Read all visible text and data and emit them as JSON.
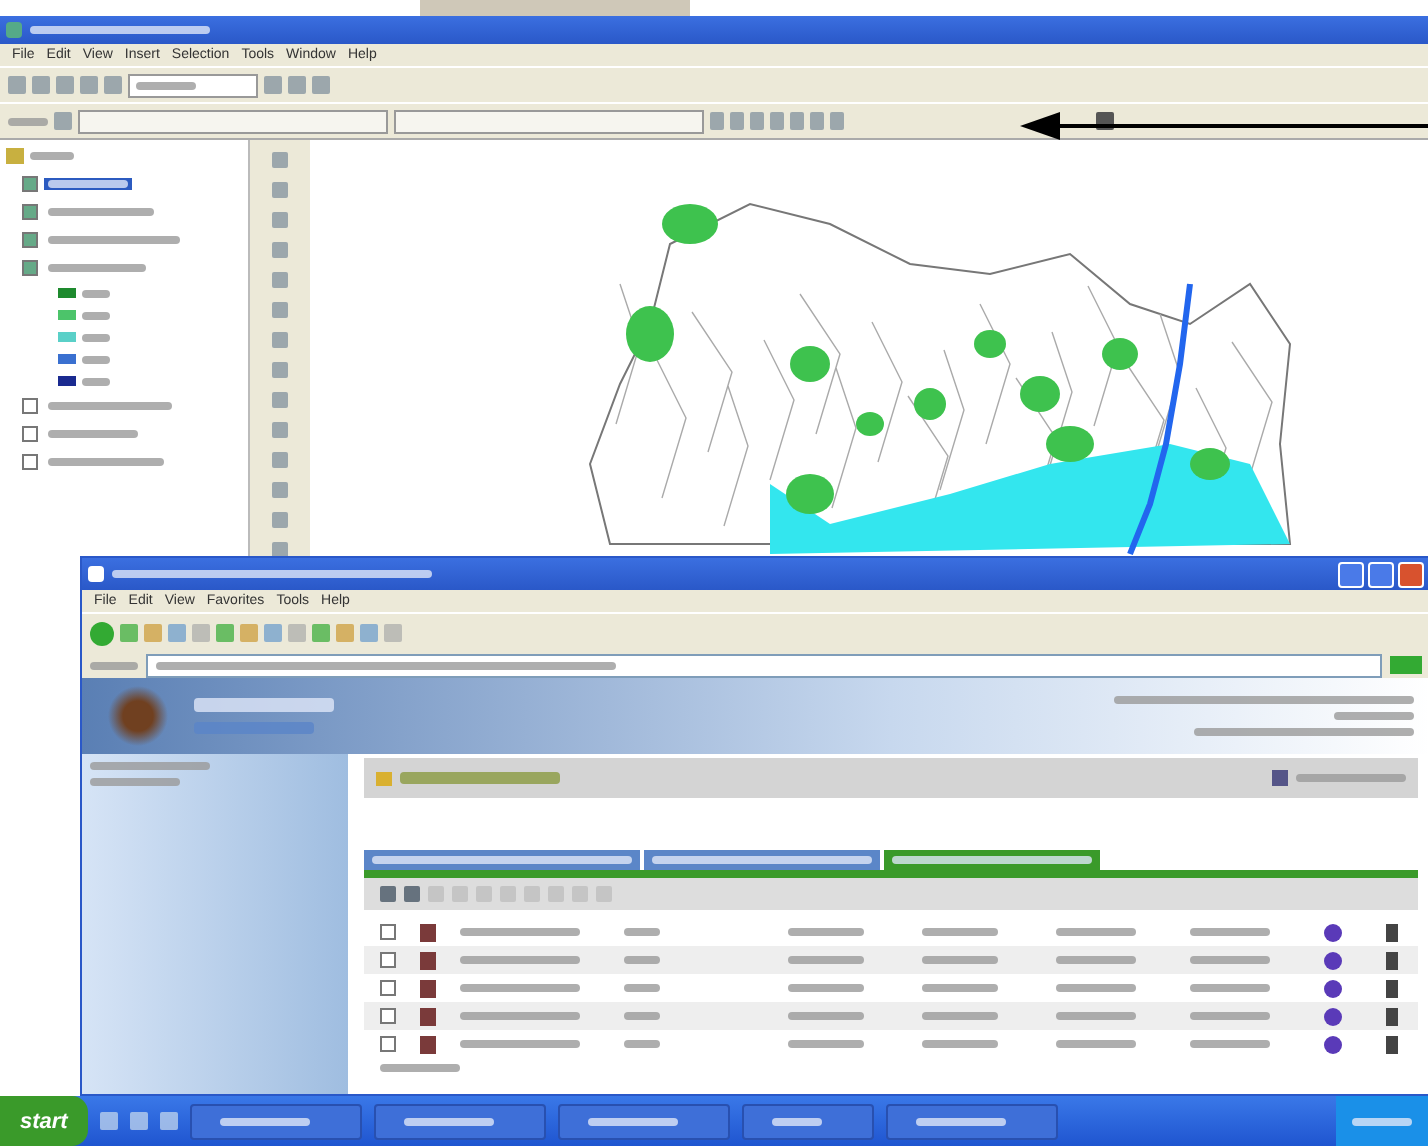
{
  "gis_window": {
    "menu": [
      "File",
      "Edit",
      "View",
      "Insert",
      "Selection",
      "Tools",
      "Window",
      "Help"
    ],
    "layers": [
      {
        "checked": true,
        "selected": true
      },
      {
        "checked": true,
        "selected": false
      },
      {
        "checked": true,
        "selected": false
      },
      {
        "checked": true,
        "selected": false
      },
      {
        "checked": false,
        "selected": false
      },
      {
        "checked": false,
        "selected": false
      },
      {
        "checked": false,
        "selected": false
      }
    ],
    "legend": [
      {
        "color": "#1e8a2e"
      },
      {
        "color": "#4cc46a"
      },
      {
        "color": "#5ad0c8"
      },
      {
        "color": "#3a70d0"
      },
      {
        "color": "#1a2a90"
      }
    ]
  },
  "browser_window": {
    "menu": [
      "File",
      "Edit",
      "View",
      "Favorites",
      "Tools",
      "Help"
    ],
    "tabs": [
      {
        "selected": false
      },
      {
        "selected": false
      },
      {
        "selected": true
      }
    ],
    "rows": [
      {
        "checked": false
      },
      {
        "checked": false
      },
      {
        "checked": false
      },
      {
        "checked": false
      },
      {
        "checked": false
      }
    ]
  },
  "taskbar": {
    "start": "start"
  }
}
